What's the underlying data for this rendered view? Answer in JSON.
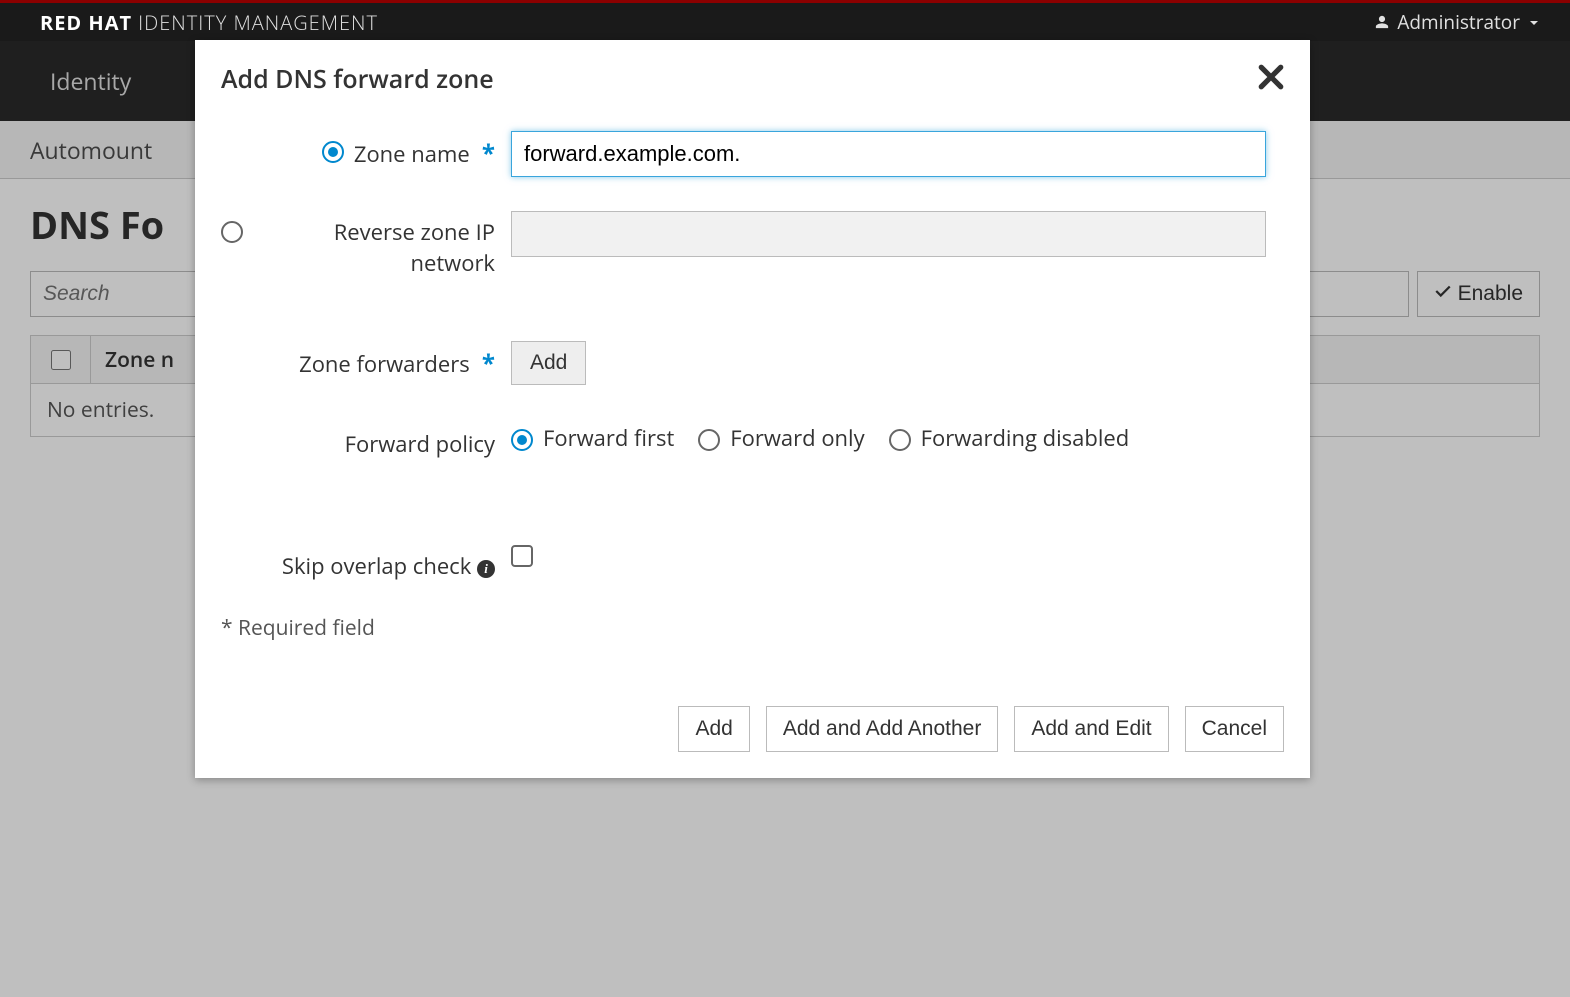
{
  "header": {
    "brand_red": "RED HAT",
    "brand_light": "IDENTITY MANAGEMENT",
    "user_label": "Administrator"
  },
  "nav": {
    "identity": "Identity"
  },
  "subnav": {
    "automount": "Automount"
  },
  "page": {
    "title_visible": "DNS Fo",
    "search_placeholder": "Search",
    "enable_label": "Enable",
    "col_zone_visible": "Zone n",
    "no_entries": "No entries."
  },
  "modal": {
    "title": "Add DNS forward zone",
    "zone_name_label": "Zone name",
    "zone_name_value": "forward.example.com.",
    "reverse_label": "Reverse zone IP network",
    "forwarders_label": "Zone forwarders",
    "forwarders_add": "Add",
    "policy_label": "Forward policy",
    "policy_options": {
      "first": "Forward first",
      "only": "Forward only",
      "disabled": "Forwarding disabled"
    },
    "skip_label": "Skip overlap check",
    "required_note": "* Required field",
    "buttons": {
      "add": "Add",
      "add_another": "Add and Add Another",
      "add_edit": "Add and Edit",
      "cancel": "Cancel"
    }
  }
}
